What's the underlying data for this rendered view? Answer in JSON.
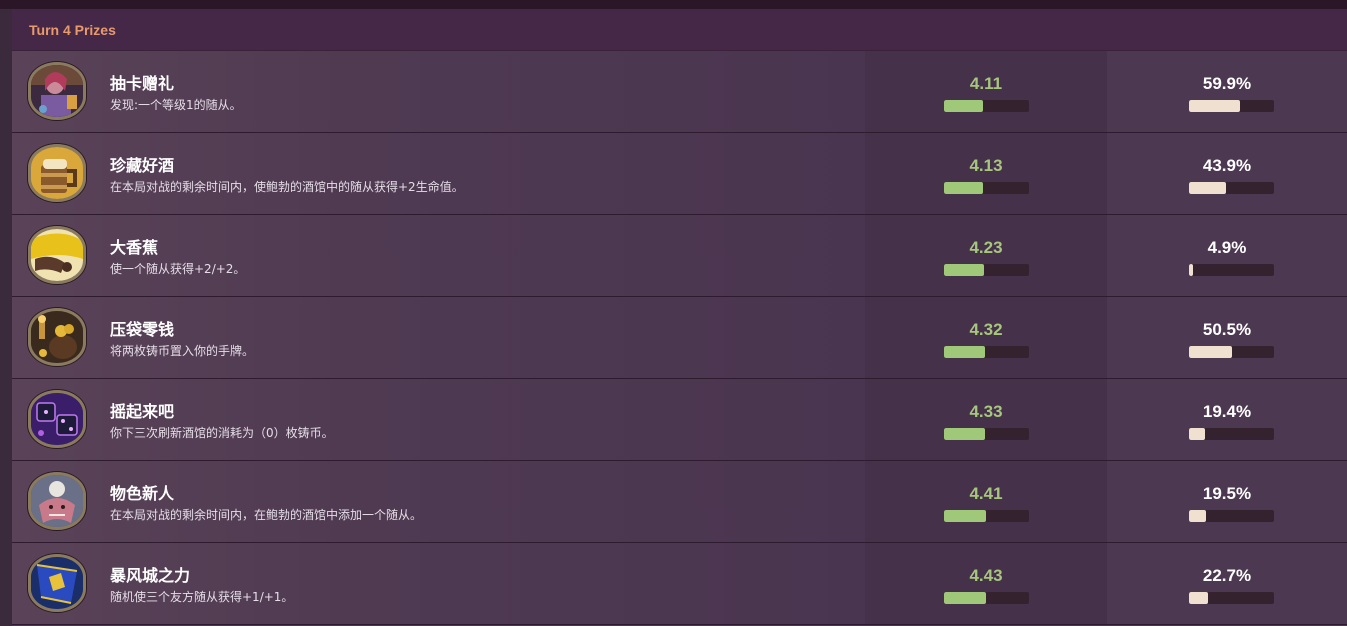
{
  "section_title": "Turn 4 Prizes",
  "colors": {
    "avg_bar": "#9fc878",
    "pick_bar": "#efe0cf",
    "avg_text": "#a6c77c",
    "title": "#e89a6c"
  },
  "avg_scale_max": 9,
  "rows": [
    {
      "name": "抽卡赠礼",
      "desc": "发现:一个等级1的随从。",
      "avg": "4.11",
      "pick": "59.9%",
      "pick_pct": 59.9,
      "icon": "barmaid-portrait-icon"
    },
    {
      "name": "珍藏好酒",
      "desc": "在本局对战的剩余时间内，使鲍勃的酒馆中的随从获得+2生命值。",
      "avg": "4.13",
      "pick": "43.9%",
      "pick_pct": 43.9,
      "icon": "beer-mug-icon"
    },
    {
      "name": "大香蕉",
      "desc": "使一个随从获得+2/+2。",
      "avg": "4.23",
      "pick": "4.9%",
      "pick_pct": 4.9,
      "icon": "banana-icon"
    },
    {
      "name": "压袋零钱",
      "desc": "将两枚铸币置入你的手牌。",
      "avg": "4.32",
      "pick": "50.5%",
      "pick_pct": 50.5,
      "icon": "coin-pouch-icon"
    },
    {
      "name": "摇起来吧",
      "desc": "你下三次刷新酒馆的消耗为（0）枚铸币。",
      "avg": "4.33",
      "pick": "19.4%",
      "pick_pct": 19.4,
      "icon": "dice-icon"
    },
    {
      "name": "物色新人",
      "desc": "在本局对战的剩余时间内，在鲍勃的酒馆中添加一个随从。",
      "avg": "4.41",
      "pick": "19.5%",
      "pick_pct": 19.5,
      "icon": "dragon-portrait-icon"
    },
    {
      "name": "暴风城之力",
      "desc": "随机使三个友方随从获得+1/+1。",
      "avg": "4.43",
      "pick": "22.7%",
      "pick_pct": 22.7,
      "icon": "stormwind-banner-icon"
    }
  ]
}
